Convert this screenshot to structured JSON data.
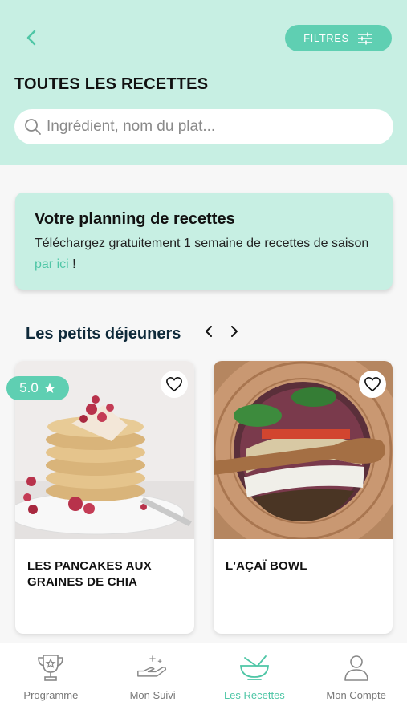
{
  "header": {
    "filters_label": "FILTRES",
    "title": "TOUTES LES RECETTES",
    "search_placeholder": "Ingrédient, nom du plat..."
  },
  "promo": {
    "title": "Votre planning de recettes",
    "text_before": "Téléchargez gratuitement 1 semaine de recettes de saison ",
    "link": "par ici",
    "text_after": " !"
  },
  "section": {
    "title": "Les petits déjeuners"
  },
  "recipes": [
    {
      "title": "LES PANCAKES AUX GRAINES DE CHIA",
      "rating": "5.0"
    },
    {
      "title": "L'AÇAÏ BOWL"
    }
  ],
  "tabs": [
    {
      "label": "Programme",
      "icon": "trophy-icon"
    },
    {
      "label": "Mon Suivi",
      "icon": "hand-sparkles-icon"
    },
    {
      "label": "Les Recettes",
      "icon": "bowl-icon",
      "active": true
    },
    {
      "label": "Mon Compte",
      "icon": "user-icon"
    }
  ],
  "colors": {
    "header_bg": "#c7efe3",
    "accent": "#5fcfb2",
    "link": "#4fc6a6"
  }
}
